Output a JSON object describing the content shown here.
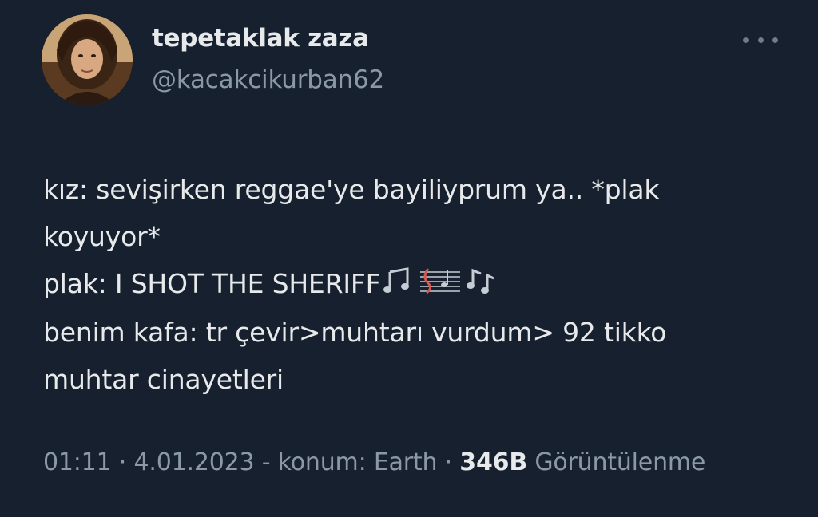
{
  "tweet": {
    "display_name": "tepetaklak zaza",
    "handle": "@kacakcikurban62",
    "more_icon": "more-horizontal-icon",
    "text_lines": [
      "kız: sevişirken reggae'ye bayiliyprum ya.. *plak",
      "koyuyor*",
      "plak: I SHOT THE SHERIFF",
      "benim kafa: tr çevir>muhtarı vurdum> 92 tikko",
      "muhtar cinayetleri"
    ],
    "emojis": [
      "musical-notes-icon",
      "musical-score-icon",
      "musical-notes-icon"
    ],
    "meta": {
      "time": "01:11",
      "sep1": " · ",
      "date": "4.01.2023",
      "location": " - konum: Earth",
      "sep2": " · ",
      "views_count": "346B",
      "views_label": " Görüntülenme"
    }
  }
}
